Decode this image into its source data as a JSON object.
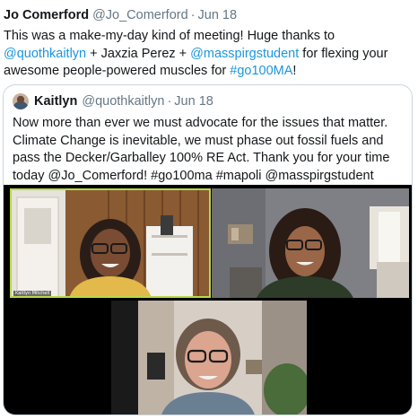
{
  "tweet": {
    "author_name": "Jo Comerford",
    "author_handle": "@Jo_Comerford",
    "separator": "·",
    "date": "Jun 18",
    "text_segments": [
      {
        "text": "This was a make-my-day kind of meeting! Huge thanks to ",
        "link": false
      },
      {
        "text": "@quothkaitlyn",
        "link": true
      },
      {
        "text": " + Jaxzia Perez + ",
        "link": false
      },
      {
        "text": "@masspirgstudent",
        "link": true
      },
      {
        "text": " for flexing your awesome people-powered muscles for ",
        "link": false
      },
      {
        "text": "#go100MA",
        "link": true
      },
      {
        "text": "!",
        "link": false
      }
    ]
  },
  "quoted_tweet": {
    "author_name": "Kaitlyn",
    "author_handle": "@quothkaitlyn",
    "separator": "·",
    "date": "Jun 18",
    "text": "Now more than ever we must advocate for the issues that matter. Climate Change is inevitable, we must phase out fossil fuels and pass the Decker/Garballey 100% RE Act. Thank you for your time today @Jo_Comerford! #go100ma #mapoli @masspirgstudent",
    "media": {
      "tile_labels": [
        "Kaitlyn Mitchell"
      ]
    }
  },
  "colors": {
    "link": "#1b95e0",
    "secondary_text": "#657786",
    "border": "#ccd6dd",
    "active_speaker_outline": "#b8d94a"
  }
}
